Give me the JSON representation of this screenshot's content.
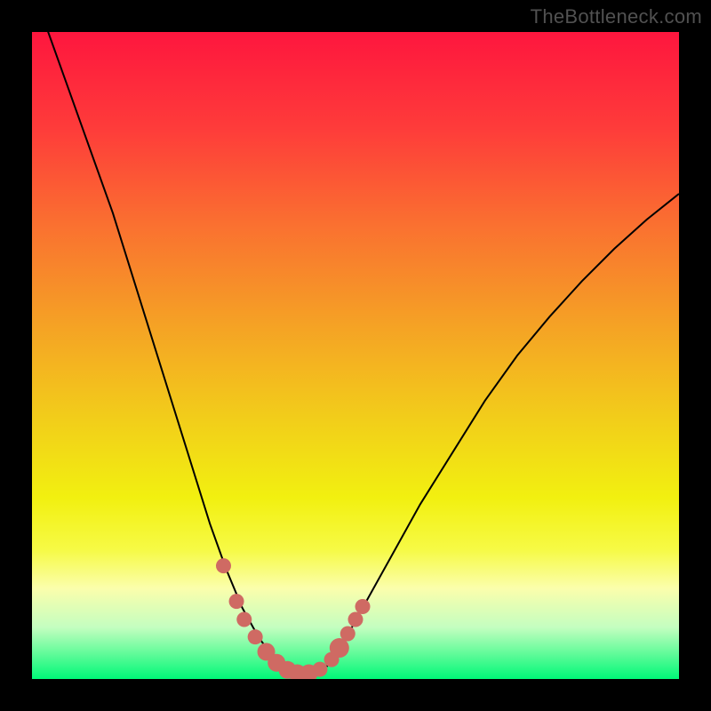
{
  "watermark": "TheBottleneck.com",
  "colors": {
    "background": "#000000",
    "watermark": "#515151",
    "curve": "#000000",
    "dot": "#cf6a63"
  },
  "chart_data": {
    "type": "line",
    "title": "",
    "xlabel": "",
    "ylabel": "",
    "xlim": [
      0,
      1
    ],
    "ylim": [
      0,
      1
    ],
    "grid": false,
    "gradient_stops": [
      {
        "offset": 0.0,
        "color": "#fe163e"
      },
      {
        "offset": 0.15,
        "color": "#fe3c3a"
      },
      {
        "offset": 0.3,
        "color": "#fa7130"
      },
      {
        "offset": 0.45,
        "color": "#f5a125"
      },
      {
        "offset": 0.6,
        "color": "#f2ce1a"
      },
      {
        "offset": 0.72,
        "color": "#f2f010"
      },
      {
        "offset": 0.8,
        "color": "#f6fa45"
      },
      {
        "offset": 0.86,
        "color": "#fbfeac"
      },
      {
        "offset": 0.92,
        "color": "#c4fec0"
      },
      {
        "offset": 0.96,
        "color": "#63fb9a"
      },
      {
        "offset": 1.0,
        "color": "#00f878"
      }
    ],
    "series": [
      {
        "name": "bottleneck-curve",
        "x": [
          0.0,
          0.025,
          0.05,
          0.075,
          0.1,
          0.125,
          0.15,
          0.175,
          0.2,
          0.225,
          0.25,
          0.275,
          0.3,
          0.325,
          0.35,
          0.375,
          0.39,
          0.4,
          0.41,
          0.42,
          0.43,
          0.44,
          0.45,
          0.46,
          0.475,
          0.5,
          0.55,
          0.6,
          0.65,
          0.7,
          0.75,
          0.8,
          0.85,
          0.9,
          0.95,
          1.0
        ],
        "y": [
          1.07,
          1.0,
          0.93,
          0.86,
          0.79,
          0.72,
          0.64,
          0.56,
          0.48,
          0.4,
          0.32,
          0.24,
          0.17,
          0.11,
          0.065,
          0.03,
          0.018,
          0.012,
          0.008,
          0.006,
          0.006,
          0.008,
          0.014,
          0.024,
          0.045,
          0.09,
          0.18,
          0.27,
          0.35,
          0.43,
          0.5,
          0.56,
          0.615,
          0.665,
          0.71,
          0.75
        ]
      }
    ],
    "marker_points": [
      {
        "x": 0.296,
        "y": 0.175,
        "r": 8.5
      },
      {
        "x": 0.316,
        "y": 0.12,
        "r": 8.5
      },
      {
        "x": 0.328,
        "y": 0.092,
        "r": 8.5
      },
      {
        "x": 0.345,
        "y": 0.065,
        "r": 8.5
      },
      {
        "x": 0.362,
        "y": 0.042,
        "r": 10.0
      },
      {
        "x": 0.378,
        "y": 0.025,
        "r": 10.0
      },
      {
        "x": 0.395,
        "y": 0.014,
        "r": 10.0
      },
      {
        "x": 0.41,
        "y": 0.009,
        "r": 10.0
      },
      {
        "x": 0.428,
        "y": 0.009,
        "r": 10.0
      },
      {
        "x": 0.445,
        "y": 0.015,
        "r": 8.5
      },
      {
        "x": 0.463,
        "y": 0.03,
        "r": 8.5
      },
      {
        "x": 0.475,
        "y": 0.048,
        "r": 11.0
      },
      {
        "x": 0.488,
        "y": 0.07,
        "r": 8.5
      },
      {
        "x": 0.5,
        "y": 0.092,
        "r": 8.5
      },
      {
        "x": 0.511,
        "y": 0.112,
        "r": 8.5
      }
    ]
  }
}
